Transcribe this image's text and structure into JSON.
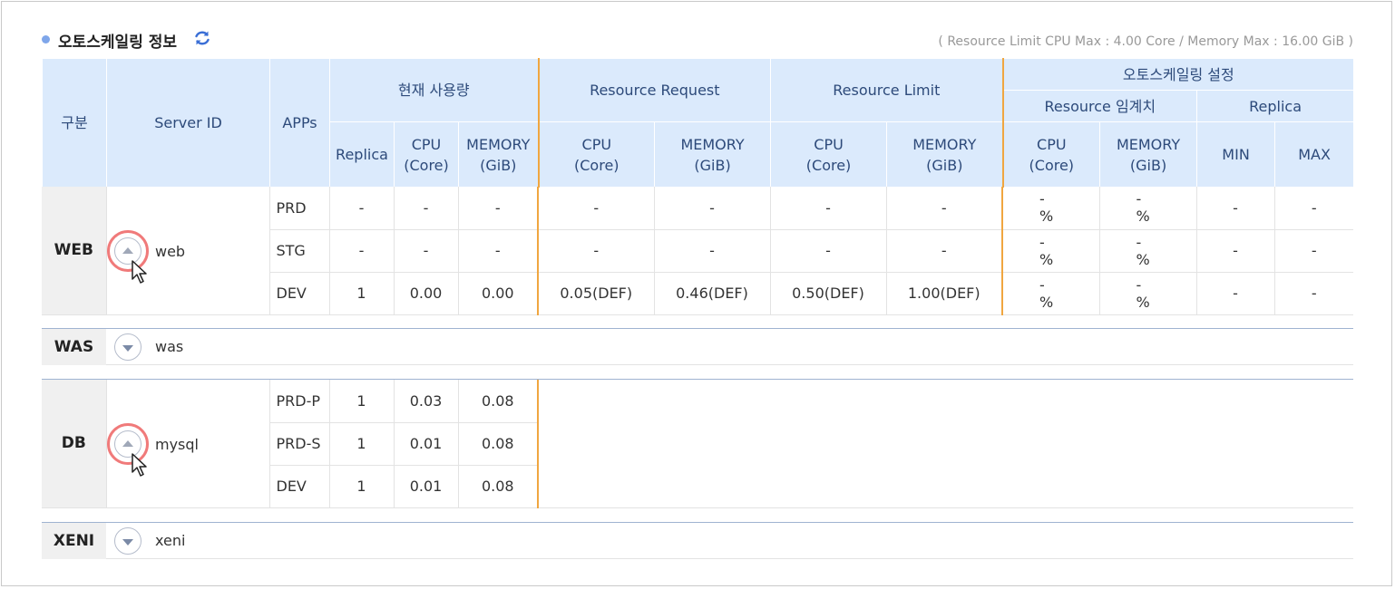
{
  "section": {
    "title": "오토스케일링 정보",
    "limit_note": "( Resource Limit CPU Max : 4.00 Core / Memory Max : 16.00 GiB )"
  },
  "header": {
    "gubun": "구분",
    "server_id": "Server ID",
    "apps": "APPs",
    "current_usage": "현재 사용량",
    "resource_request": "Resource Request",
    "resource_limit": "Resource Limit",
    "autoscaling_setting": "오토스케일링 설정",
    "resource_threshold": "Resource 임계치",
    "replica_group": "Replica",
    "replica": "Replica",
    "cpu": "CPU",
    "core": "(Core)",
    "memory": "MEMORY",
    "gib": "(GiB)",
    "min": "MIN",
    "max": "MAX"
  },
  "web": {
    "gubun": "WEB",
    "server": "web",
    "rows": [
      {
        "app": "PRD",
        "replica": "-",
        "cpu": "-",
        "mem": "-",
        "req_cpu": "-",
        "req_mem": "-",
        "lim_cpu": "-",
        "lim_mem": "-",
        "th_cpu": "-",
        "th_mem": "-",
        "min": "-",
        "max": "-"
      },
      {
        "app": "STG",
        "replica": "-",
        "cpu": "-",
        "mem": "-",
        "req_cpu": "-",
        "req_mem": "-",
        "lim_cpu": "-",
        "lim_mem": "-",
        "th_cpu": "-",
        "th_mem": "-",
        "min": "-",
        "max": "-"
      },
      {
        "app": "DEV",
        "replica": "1",
        "cpu": "0.00",
        "mem": "0.00",
        "req_cpu": "0.05(DEF)",
        "req_mem": "0.46(DEF)",
        "lim_cpu": "0.50(DEF)",
        "lim_mem": "1.00(DEF)",
        "th_cpu": "-",
        "th_mem": "-",
        "min": "-",
        "max": "-"
      }
    ]
  },
  "was": {
    "gubun": "WAS",
    "server": "was"
  },
  "db": {
    "gubun": "DB",
    "server": "mysql",
    "rows": [
      {
        "app": "PRD-P",
        "replica": "1",
        "cpu": "0.03",
        "mem": "0.08"
      },
      {
        "app": "PRD-S",
        "replica": "1",
        "cpu": "0.01",
        "mem": "0.08"
      },
      {
        "app": "DEV",
        "replica": "1",
        "cpu": "0.01",
        "mem": "0.08"
      }
    ]
  },
  "xeni": {
    "gubun": "XENI",
    "server": "xeni"
  },
  "pct_symbol": "%",
  "colors": {
    "header_bg": "#dbeafc",
    "accent_separator": "#f0a640",
    "highlight_ring": "#f07a7a"
  }
}
